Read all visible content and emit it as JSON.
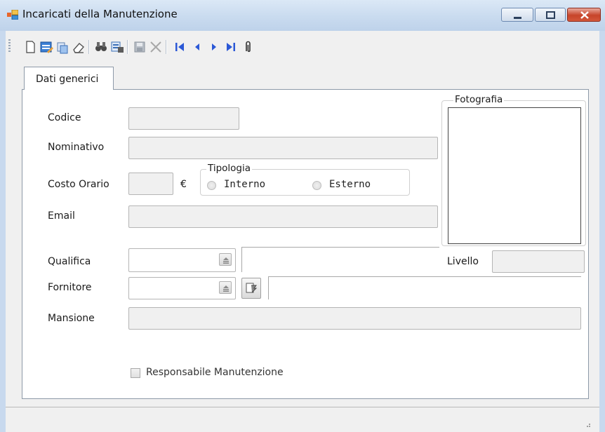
{
  "window": {
    "title": "Incaricati della Manutenzione"
  },
  "toolbar": {
    "buttons": [
      "new-icon",
      "edit-icon",
      "copy-icon",
      "eraser-icon",
      "find-icon",
      "search-record-icon",
      "save-icon",
      "delete-icon",
      "first-record-icon",
      "previous-record-icon",
      "next-record-icon",
      "last-record-icon",
      "attachment-icon"
    ]
  },
  "tabs": [
    {
      "label": "Dati generici"
    }
  ],
  "form": {
    "codice_label": "Codice",
    "codice_value": "",
    "nominativo_label": "Nominativo",
    "nominativo_value": "",
    "costo_orario_label": "Costo Orario",
    "costo_orario_value": "",
    "currency_symbol": "€",
    "tipologia": {
      "title": "Tipologia",
      "options": [
        {
          "label": "Interno",
          "checked": false
        },
        {
          "label": "Esterno",
          "checked": false
        }
      ]
    },
    "email_label": "Email",
    "email_value": "",
    "qualifica_label": "Qualifica",
    "qualifica_value": "",
    "livello_label": "Livello",
    "livello_value": "",
    "fornitore_label": "Fornitore",
    "fornitore_value": "",
    "mansione_label": "Mansione",
    "mansione_value": "",
    "fotografia_title": "Fotografia",
    "responsabile_label": "Responsabile Manutenzione",
    "responsabile_checked": false
  },
  "colors": {
    "titlebar": "#c9dbef",
    "close_button": "#c7442a",
    "toolbar_blue": "#2b58d6"
  }
}
